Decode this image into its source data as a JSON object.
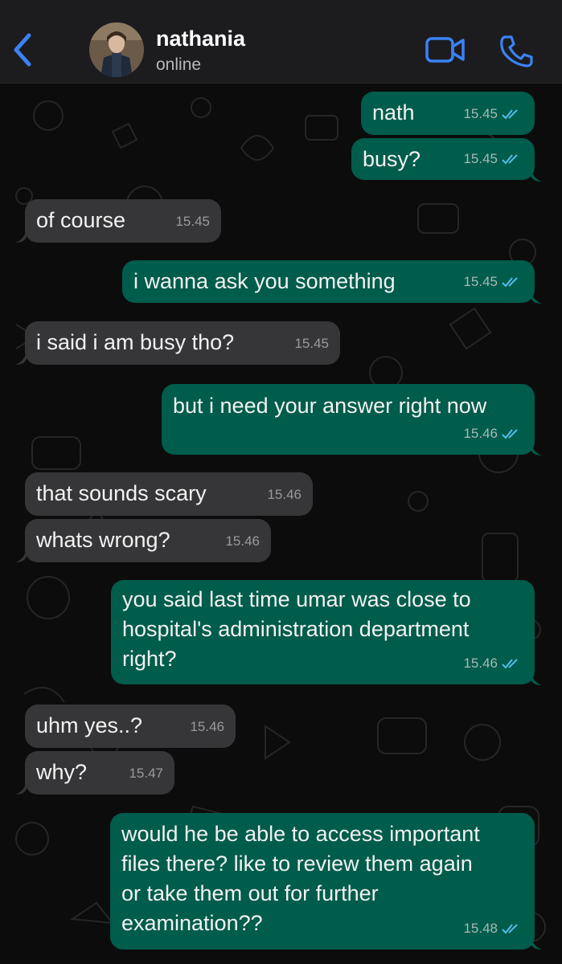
{
  "header": {
    "contact_name": "nathania",
    "status": "online",
    "accent_color": "#3b82f6"
  },
  "messages": [
    {
      "direction": "out",
      "text": "nath",
      "time": "15.45",
      "read": true
    },
    {
      "direction": "out",
      "text": "busy?",
      "time": "15.45",
      "read": true
    },
    {
      "direction": "in",
      "text": "of course",
      "time": "15.45"
    },
    {
      "direction": "out",
      "text": "i wanna ask you something",
      "time": "15.45",
      "read": true
    },
    {
      "direction": "in",
      "text": "i said i am busy tho?",
      "time": "15.45"
    },
    {
      "direction": "out",
      "text": "but i need your answer right now",
      "time": "15.46",
      "read": true
    },
    {
      "direction": "in",
      "text": "that sounds scary",
      "time": "15.46"
    },
    {
      "direction": "in",
      "text": "whats wrong?",
      "time": "15.46"
    },
    {
      "direction": "out",
      "text": "you said last time umar was close to\nhospital's administration department\nright?",
      "time": "15.46",
      "read": true
    },
    {
      "direction": "in",
      "text": "uhm yes..?",
      "time": "15.46"
    },
    {
      "direction": "in",
      "text": "why?",
      "time": "15.47"
    },
    {
      "direction": "out",
      "text": "would he be able to access important\nfiles there? like to review them again\nor take them out for further\nexamination??",
      "time": "15.48",
      "read": true
    }
  ],
  "colors": {
    "outgoing_bubble": "#005c4b",
    "incoming_bubble": "#363638",
    "read_ticks": "#53bdeb"
  },
  "icons": {
    "back": "chevron-left-icon",
    "video": "video-camera-icon",
    "call": "phone-icon",
    "read_receipt": "double-check-icon"
  }
}
